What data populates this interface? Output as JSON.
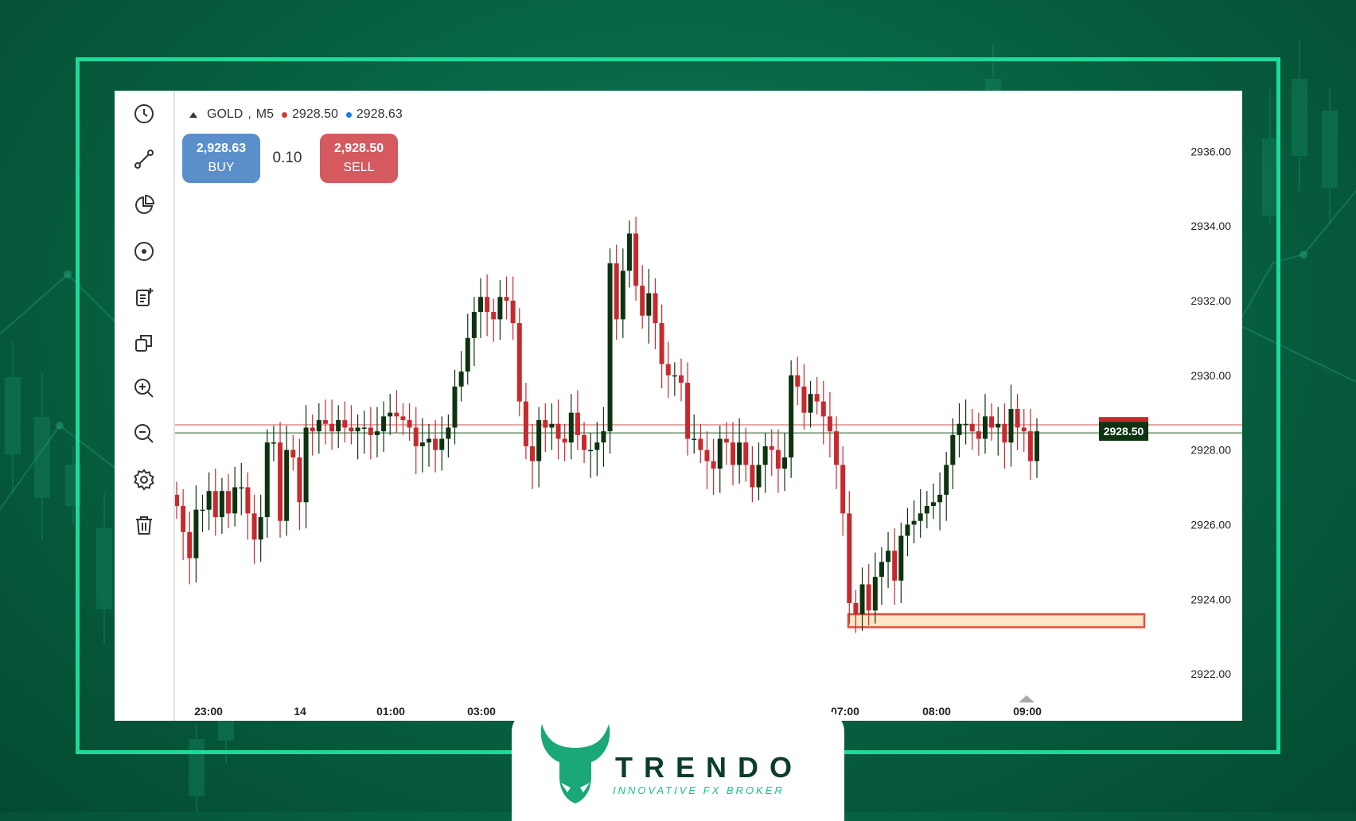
{
  "header": {
    "symbol": "GOLD",
    "timeframe": "M5",
    "bid": "2928.50",
    "ask": "2928.63"
  },
  "trade_panel": {
    "buy_price": "2,928.63",
    "buy_label": "BUY",
    "lot": "0.10",
    "sell_price": "2,928.50",
    "sell_label": "SELL"
  },
  "toolbar": {
    "tools": [
      "clock-icon",
      "trendline-icon",
      "pie-icon",
      "target-icon",
      "clipboard-add-icon",
      "copy-icon",
      "zoom-in-icon",
      "zoom-out-icon",
      "settings-icon",
      "trash-icon"
    ]
  },
  "colors": {
    "up": "#0d3311",
    "down": "#c62a2e",
    "buy": "#5b8fcb",
    "sell": "#d45a5f",
    "zone": "#fde7c4",
    "zone_border": "#e84c3d",
    "frame": "#1ed99a"
  },
  "chart_data": {
    "type": "candlestick",
    "price_ticks": [
      "2936.00",
      "2934.00",
      "2932.00",
      "2930.00",
      "2928.00",
      "2926.00",
      "2924.00",
      "2922.00"
    ],
    "time_ticks": [
      "23:00",
      "14",
      "01:00",
      "03:00",
      "07:00",
      "08:00",
      "09:00"
    ],
    "current_price_label": "2928.50",
    "bid_line": 2928.5,
    "ask_line": 2928.63,
    "support_zone": [
      2923.25,
      2923.6
    ],
    "ylim": [
      2921.0,
      2937.2
    ],
    "closes": [
      2926.5,
      2925.8,
      2925.1,
      2926.4,
      2926.4,
      2926.9,
      2926.2,
      2926.9,
      2926.3,
      2927.0,
      2927.0,
      2926.3,
      2925.6,
      2926.2,
      2928.2,
      2928.2,
      2926.1,
      2928.0,
      2927.8,
      2926.6,
      2928.6,
      2928.5,
      2928.8,
      2928.7,
      2928.5,
      2928.8,
      2928.6,
      2928.5,
      2928.6,
      2928.6,
      2928.4,
      2928.5,
      2928.9,
      2929.0,
      2928.9,
      2928.8,
      2928.6,
      2928.1,
      2928.2,
      2928.3,
      2928.0,
      2928.3,
      2928.6,
      2929.7,
      2930.1,
      2931.0,
      2931.7,
      2932.1,
      2931.7,
      2931.5,
      2932.1,
      2932.0,
      2931.4,
      2929.3,
      2928.1,
      2927.7,
      2928.8,
      2928.6,
      2928.7,
      2928.3,
      2928.2,
      2929.0,
      2928.4,
      2928.0,
      2928.0,
      2928.2,
      2928.5,
      2933.0,
      2931.5,
      2932.8,
      2933.8,
      2932.4,
      2931.6,
      2932.2,
      2931.4,
      2930.3,
      2930.0,
      2930.0,
      2929.8,
      2928.3,
      2928.3,
      2928.0,
      2927.7,
      2927.5,
      2928.3,
      2928.2,
      2927.6,
      2928.2,
      2927.6,
      2927.0,
      2927.6,
      2928.1,
      2928.0,
      2927.5,
      2927.8,
      2930.0,
      2929.7,
      2929.0,
      2929.5,
      2929.3,
      2928.9,
      2928.5,
      2927.6,
      2926.3,
      2923.9,
      2923.6,
      2924.4,
      2923.7,
      2924.6,
      2925.0,
      2925.3,
      2924.5,
      2925.7,
      2926.0,
      2926.1,
      2926.3,
      2926.5,
      2926.6,
      2926.8,
      2927.6,
      2928.4,
      2928.7,
      2928.7,
      2928.5,
      2928.3,
      2928.9,
      2928.6,
      2928.7,
      2928.2,
      2929.1,
      2928.6,
      2928.5,
      2927.7,
      2928.5
    ],
    "series": [
      {
        "name": "GOLD, M5",
        "type": "candlestick"
      }
    ]
  },
  "brand": {
    "name": "TRENDO",
    "tagline": "INNOVATIVE FX BROKER"
  }
}
